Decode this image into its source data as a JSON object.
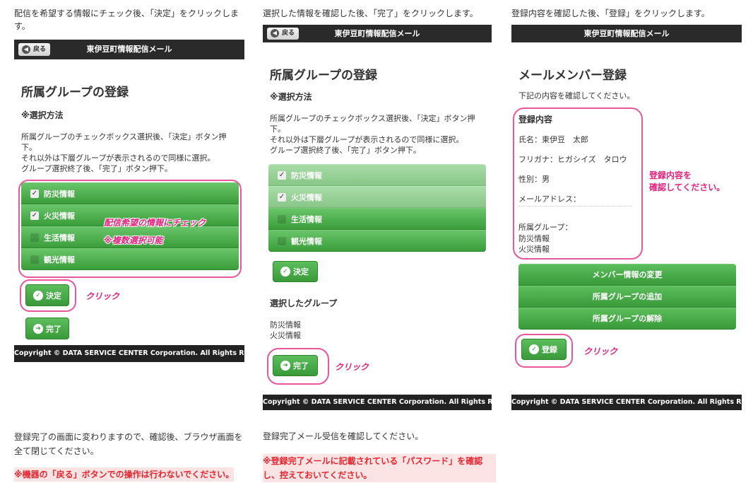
{
  "instructions": {
    "panel1": "配信を希望する情報にチェック後、「決定」をクリックします。",
    "panel2": "選択した情報を確認した後、「完了」をクリックします。",
    "panel3": "登録内容を確認した後、「登録」をクリックします。"
  },
  "header": {
    "back_label": "戻る",
    "back_icon": "arrow-left-circle",
    "title": "東伊豆町情報配信メール"
  },
  "panel1": {
    "heading": "所属グループの登録",
    "method_title": "※選択方法",
    "method_lines": [
      "所属グループのチェックボックス選択後、「決定」ボタン押下。",
      "それ以外は下層グループが表示されるので同様に選択。",
      "グループ選択終了後、「完了」ボタン押下。"
    ],
    "checkboxes": [
      {
        "label": "防災情報",
        "checked": true
      },
      {
        "label": "火災情報",
        "checked": true
      },
      {
        "label": "生活情報",
        "checked": false
      },
      {
        "label": "観光情報",
        "checked": false
      }
    ],
    "annotation_line1": "配信希望の情報にチェック",
    "annotation_line2": "※複数選択可能",
    "decide_label": "決定",
    "decide_icon": "check-icon",
    "click_label": "クリック",
    "done_label": "完了",
    "done_icon": "arrow-right-icon",
    "footer": "Copyright © DATA SERVICE CENTER Corporation. All Rights Reser..."
  },
  "panel2": {
    "heading": "所属グループの登録",
    "method_title": "※選択方法",
    "method_lines": [
      "所属グループのチェックボックス選択後、「決定」ボタン押下。",
      "それ以外は下層グループが表示されるので同様に選択。",
      "グループ選択終了後、「完了」ボタン押下。"
    ],
    "checkboxes": [
      {
        "label": "防災情報",
        "checked": true
      },
      {
        "label": "火災情報",
        "checked": true
      },
      {
        "label": "生活情報",
        "checked": false
      },
      {
        "label": "観光情報",
        "checked": false
      }
    ],
    "decide_label": "決定",
    "selected_title": "選択したグループ",
    "selected_items": [
      "防災情報",
      "火災情報"
    ],
    "done_label": "完了",
    "click_label": "クリック",
    "footer": "Copyright © DATA SERVICE CENTER Corporation. All Rights Reserved."
  },
  "panel3": {
    "heading": "メールメンバー登録",
    "confirm_text": "下記の内容を確認してください。",
    "section_title": "登録内容",
    "name": "氏名：東伊豆　太郎",
    "kana": "フリガナ：ヒガシイズ　タロウ",
    "gender": "性別：男",
    "email": "メールアドレス：",
    "group_label": "所属グループ：",
    "groups": [
      "防災情報",
      "火災情報"
    ],
    "annotation_line1": "登録内容を",
    "annotation_line2": "確認してください。",
    "btn_change": "メンバー情報の変更",
    "btn_add": "所属グループの追加",
    "btn_remove": "所属グループの解除",
    "register_label": "登録",
    "click_label": "クリック",
    "footer": "Copyright © DATA SERVICE CENTER Corporation. All Rights Reserved."
  },
  "bottom": {
    "left_text": "登録完了の画面に変わりますので、確認後、ブラウザ画面を全て閉じてください。",
    "left_warning": "※機器の「戻る」ボタンでの操作は行わないでください。",
    "right_text": "登録完了メール受信を確認してください。",
    "right_warning": "※登録完了メールに記載されている「パスワード」を確認し、控えておいてください。"
  },
  "colors": {
    "header_bg": "#2a2a2a",
    "button_green": "#3a9a3a",
    "annotation_pink": "#e2227b",
    "warning_red": "#e8242d"
  }
}
